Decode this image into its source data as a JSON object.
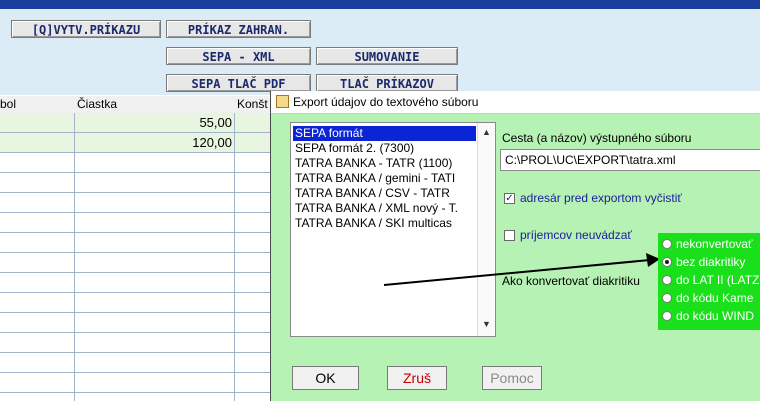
{
  "toolbar": {
    "btn_vytv": "[Q]VYTV.PRÍKAZU",
    "btn_zahran": "PRÍKAZ ZAHRAN.",
    "btn_sepa_xml": "SEPA - XML",
    "btn_sumovanie": "SUMOVANIE",
    "btn_sepa_tlac": "SEPA TLAČ PDF",
    "btn_tlac_prikazov": "TLAČ PRÍKAZOV"
  },
  "table": {
    "columns": [
      "bol",
      "Čiastka",
      "Konšt"
    ],
    "rows": [
      {
        "amount": "55,00"
      },
      {
        "amount": "120,00"
      }
    ]
  },
  "dialog": {
    "title": "Export údajov do textového súboru",
    "formats": [
      "SEPA formát",
      "SEPA formát 2. (7300)",
      "TATRA BANKA - TATR (1100)",
      "TATRA BANKA / gemini - TATI",
      "TATRA BANKA / CSV - TATR",
      "TATRA BANKA / XML nový - T.",
      "TATRA BANKA / SKI multicas"
    ],
    "path_label": "Cesta (a názov) výstupného súboru",
    "path_value": "C:\\PROL\\UC\\EXPORT\\tatra.xml",
    "clear_dir_label": "adresár pred exportom vyčistiť",
    "no_recipients_label": "príjemcov neuvádzať",
    "diacritics_label": "Ako konvertovať diakritiku",
    "diacritics_options": [
      "nekonvertovať",
      "bez diakritiky",
      "do LAT II (LATZ",
      "do kódu Kame",
      "do kódu WIND"
    ],
    "ok_label": "OK",
    "cancel_label": "Zruš",
    "help_label": "Pomoc"
  },
  "colors": {
    "dialog_bg": "#b6f2b4",
    "radio_group_bg": "#19e01b",
    "selection": "#0a24d6"
  }
}
